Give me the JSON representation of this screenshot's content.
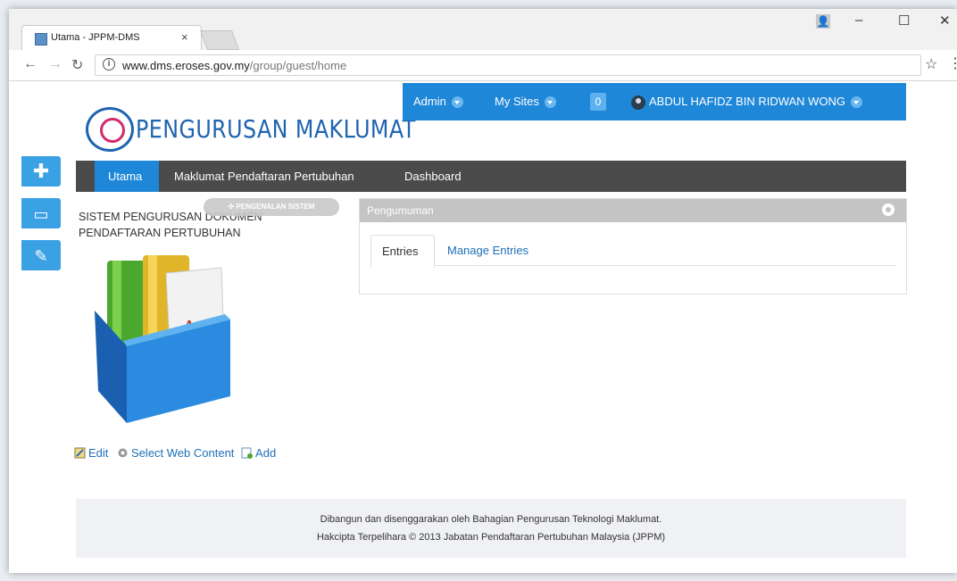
{
  "browser": {
    "tab_title": "Utama - JPPM-DMS",
    "tab_close": "×",
    "url_host": "www.dms.eroses.gov.my",
    "url_path": "/group/guest/home",
    "window_controls": [
      "–",
      "☐",
      "✕"
    ]
  },
  "logo": {
    "text": "PENGURUSAN MAKLUMAT"
  },
  "topnav": {
    "admin": "Admin",
    "my_sites": "My Sites",
    "notification_count": "0",
    "user_name": "ABDUL HAFIDZ BIN RIDWAN WONG"
  },
  "dock": {
    "icons": [
      "plus-icon",
      "monitor-icon",
      "edit-icon"
    ]
  },
  "mainnav": {
    "items": [
      "Utama",
      "Maklumat Pendaftaran Pertubuhan",
      "Dashboard"
    ],
    "active": "Utama"
  },
  "portlet": {
    "tag": "✣ PENGENALAN SISTEM",
    "title_line1": "SISTEM PENGURUSAN DOKUMEN",
    "title_line2": "PENDAFTARAN PERTUBUHAN"
  },
  "actions": {
    "edit": "Edit",
    "select": "Select Web Content",
    "add": "Add"
  },
  "announcement": {
    "title": "Pengumuman",
    "tabs": [
      "Entries",
      "Manage Entries"
    ]
  },
  "footer": {
    "line1": "Dibangun dan disenggarakan oleh Bahagian Pengurusan Teknologi Maklumat.",
    "line2": "Hakcipta Terpelihara © 2013 Jabatan Pendaftaran Pertubuhan Malaysia (JPPM)"
  },
  "colors": {
    "brand_blue": "#1e87d8",
    "nav_dark": "#4b4b4b",
    "dock_blue": "#3ba1e5"
  }
}
